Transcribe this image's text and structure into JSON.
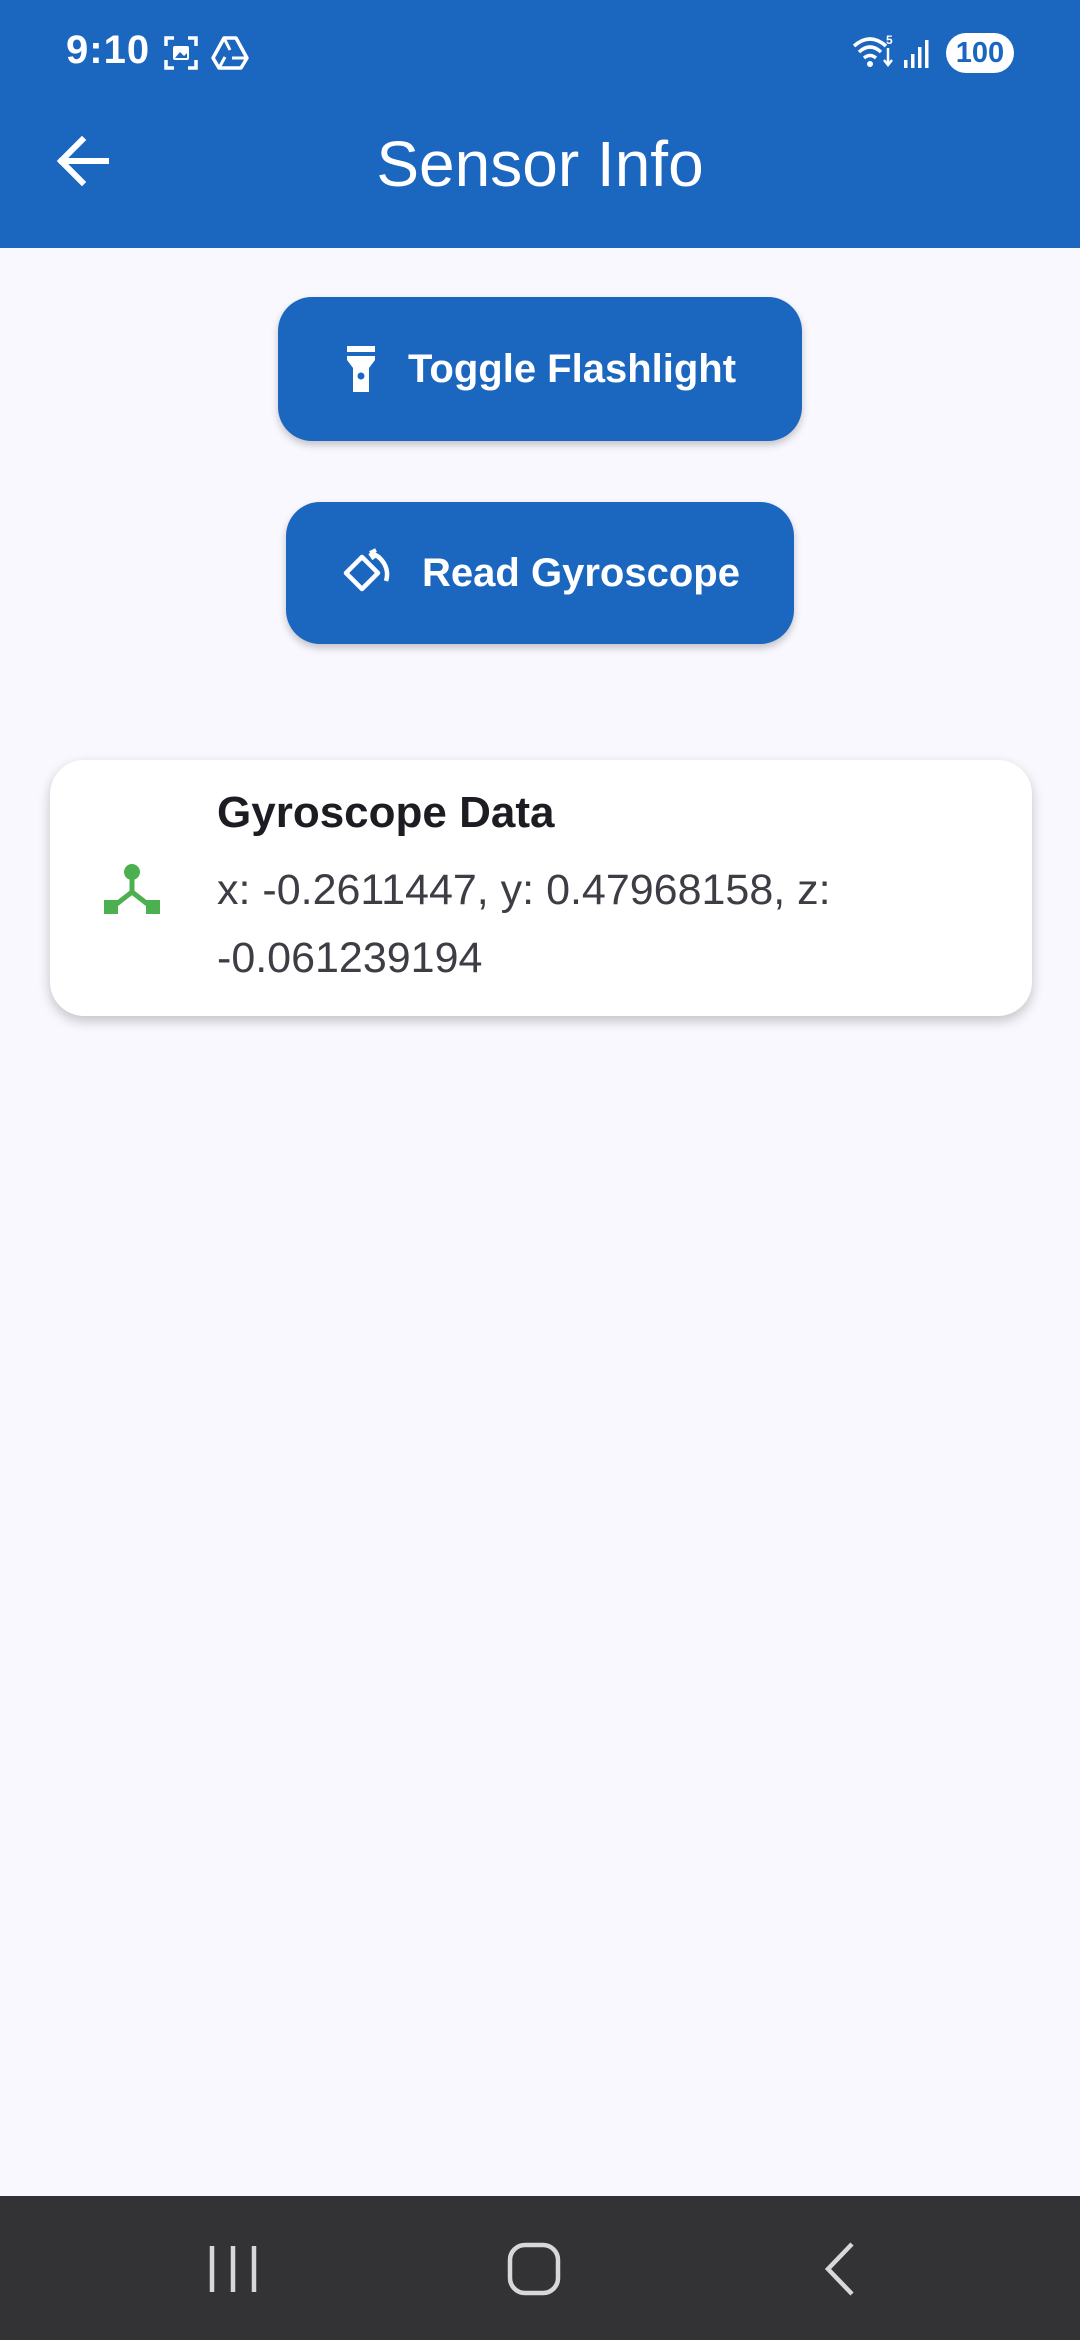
{
  "status_bar": {
    "time": "9:10",
    "battery": "100",
    "icons": [
      "screenshot-icon",
      "drive-icon",
      "wifi-icon",
      "signal-icon"
    ]
  },
  "app_bar": {
    "title": "Sensor Info",
    "back_icon": "arrow-left-icon"
  },
  "buttons": {
    "flashlight": {
      "label": "Toggle Flashlight",
      "icon": "flashlight-icon"
    },
    "gyroscope": {
      "label": "Read Gyroscope",
      "icon": "rotate-icon"
    }
  },
  "card": {
    "title": "Gyroscope Data",
    "body": "x: -0.2611447, y: 0.47968158, z: -0.061239194",
    "icon": "device-hub-icon"
  },
  "nav_bar": {
    "items": [
      "recents-icon",
      "home-icon",
      "back-icon"
    ]
  },
  "colors": {
    "primary": "#1b66bf",
    "background": "#f8f8fe",
    "accent_green": "#4caf50",
    "nav_bar": "#333336"
  }
}
